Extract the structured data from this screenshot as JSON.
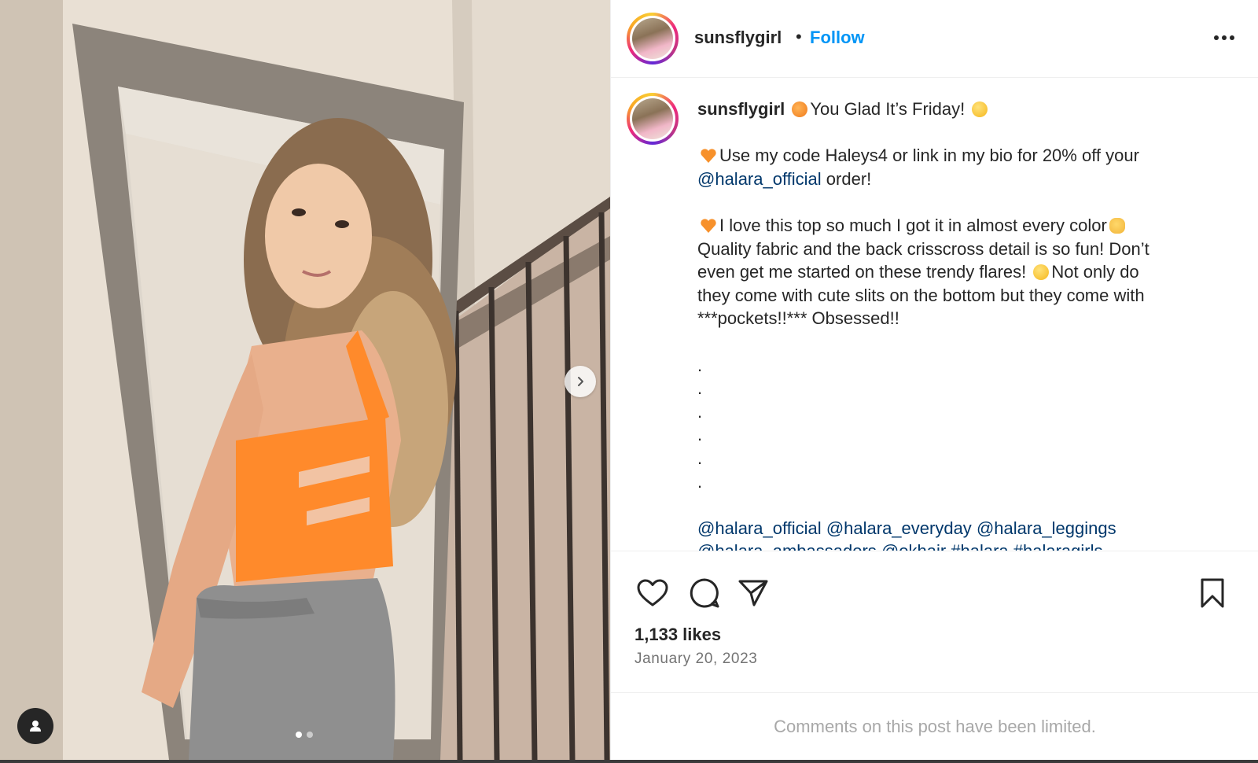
{
  "post": {
    "username": "sunsflygirl",
    "separator": "•",
    "follow_label": "Follow",
    "more_icon": "more-horizontal-icon"
  },
  "caption": {
    "username": "sunsflygirl",
    "line1": "You Glad It’s Friday!",
    "para2_part1": "Use my code Haleys4 or link in my bio for 20% off your",
    "para2_mention": "@halara_official",
    "para2_part2": " order!",
    "para3_line1": "I love this top so much I got it in almost every color",
    "para3_line2": "Quality fabric and the back crisscross detail is so fun! Don’t",
    "para3_line3_a": "even get me started on these trendy flares!",
    "para3_line3_b": "Not only do",
    "para3_line4": "they come with cute slits on the bottom but they come with",
    "para3_line5": "***pockets!!*** Obsessed!!",
    "dots": [
      ".",
      ".",
      ".",
      ".",
      ".",
      "."
    ],
    "tags_line1": [
      "@halara_official",
      "@halara_everyday",
      "@halara_leggings"
    ],
    "tags_line2": "@halara_ambassadors @okhair #halara #halaragirls"
  },
  "stats": {
    "likes": "1,133 likes",
    "date": "January 20, 2023"
  },
  "comments": {
    "notice": "Comments on this post have been limited."
  },
  "carousel": {
    "pages": 2,
    "current": 1
  },
  "colors": {
    "follow": "#0095f6",
    "mention": "#00376b",
    "muted": "#737373",
    "notice": "#a8a8a8"
  }
}
